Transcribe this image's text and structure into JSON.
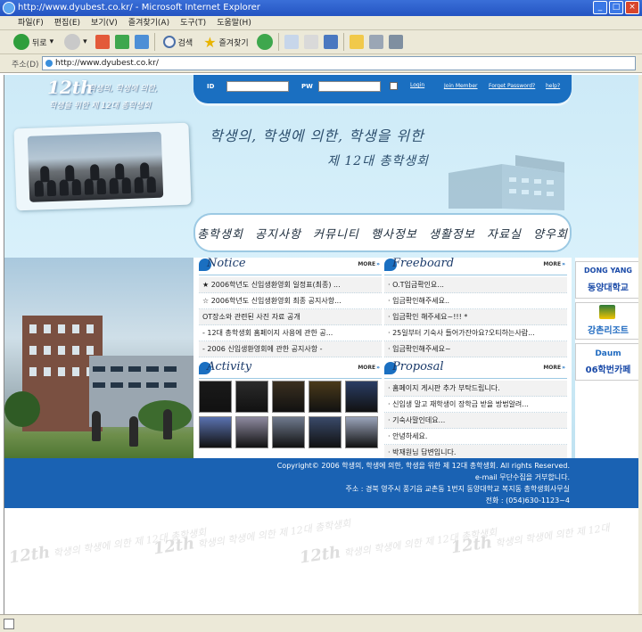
{
  "window": {
    "title": "http://www.dyubest.co.kr/ - Microsoft Internet Explorer"
  },
  "menu": [
    "파일(F)",
    "편집(E)",
    "보기(V)",
    "즐겨찾기(A)",
    "도구(T)",
    "도움말(H)"
  ],
  "toolbar": {
    "back_label": "뒤로",
    "search_label": "검색",
    "favorites_label": "즐겨찾기"
  },
  "address": {
    "label": "주소(D)",
    "url": "http://www.dyubest.co.kr/"
  },
  "site": {
    "logo_number": "12th",
    "logo_line1": "학생의, 학생에 의한,",
    "logo_line2": "학생을 위한 제 12대 총학생회",
    "slogan_line1": "학생의, 학생에 의한, 학생을 위한",
    "slogan_line2": "제 12대 총학생회"
  },
  "login": {
    "id_label": "ID",
    "pw_label": "PW",
    "login_button": "Login",
    "join_link": "Join Member",
    "forgot_link": "Forget Password?",
    "help_link": "help?"
  },
  "nav": [
    "총학생회",
    "공지사항",
    "커뮤니티",
    "행사정보",
    "생활정보",
    "자료실",
    "양우회"
  ],
  "notice": {
    "title": "Notice",
    "more": "MORE",
    "items": [
      "★ 2006학년도 신입생환영회 일정표(최종) ...",
      "☆ 2006학년도 신입생환영회 최종 공지사항...",
      "OT장소와 관련된 사진 자료 공개",
      "- 12대 총학생회 홈페이지 사용에 관한 공...",
      "- 2006 신입생환영회에 관한 공지사항 -"
    ]
  },
  "freeboard": {
    "title": "Freeboard",
    "more": "MORE",
    "items": [
      "· O.T입금확인요...",
      "· 입금확인해주세요..",
      "· 입금확인 해주세요~!!! *",
      "· 25일부터 기숙사 들어가잔아요?오티하는사람...",
      "· 입금확인해주세요~"
    ]
  },
  "activity": {
    "title": "Activity",
    "more": "MORE",
    "thumb_colors": [
      "#1a1a1a",
      "#2b2b2b",
      "#3b3020",
      "#4a3a1a",
      "#2a3d64",
      "#5a72b0",
      "#8e8aa0",
      "#6f7a8e",
      "#3a4a6a",
      "#9aa4bb"
    ]
  },
  "proposal": {
    "title": "Proposal",
    "more": "MORE",
    "items": [
      "· 홈페이지 게시판 추가 부탁드립니다.",
      "· 신입생 말고 재학생이 장학금 받을 방법알려...",
      "· 기숙사말인데요...",
      "· 안녕하세요.",
      "· 박재원님 답변입니다."
    ]
  },
  "banners": {
    "dongyang_top": "DONG YANG",
    "dongyang_bottom": "동양대학교",
    "resort": "강촌리조트",
    "cafe_top": "Daum",
    "cafe_bottom": "06학번카페"
  },
  "footer": {
    "copyright": "Copyright© 2006 학생의, 학생에 의한, 학생을 위한 제 12대 총학생회. All rights Reserved.",
    "email_notice": "e-mail 무단수집을 거부합니다.",
    "address": "주소 : 경북 영주시 풍기읍 교촌동 1번지 동양대학교 복지동 총학생회사무실",
    "phone": "전화 : (054)630-1123~4"
  },
  "colors": {
    "accent": "#1a6fc1",
    "footer_bg": "#1a62b3",
    "chrome": "#ece9d8"
  }
}
